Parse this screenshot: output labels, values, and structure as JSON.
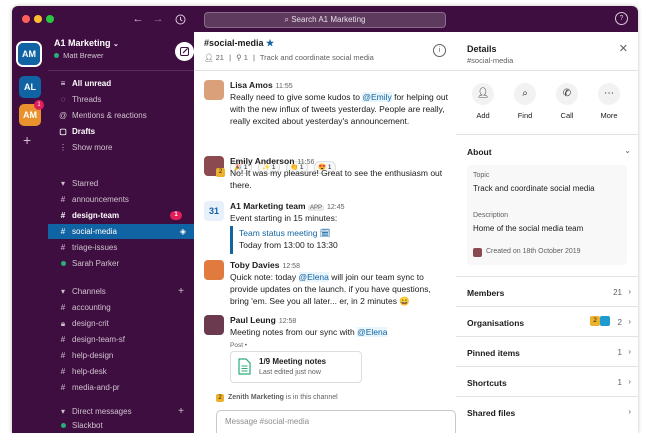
{
  "window": {
    "search_placeholder": "Search A1 Marketing",
    "traffic_colors": [
      "#ff5f57",
      "#febc2e",
      "#28c840"
    ]
  },
  "workspaces": [
    {
      "label": "AM",
      "color": "#1164a3",
      "selected": true
    },
    {
      "label": "AL",
      "color": "#1164a3"
    },
    {
      "label": "AM",
      "color": "#e8912d",
      "badge": "1"
    }
  ],
  "sidebar": {
    "workspace_name": "A1 Marketing",
    "user_name": "Matt Brewer",
    "nav": [
      {
        "label": "All unread",
        "bold": true
      },
      {
        "label": "Threads"
      },
      {
        "label": "Mentions & reactions"
      },
      {
        "label": "Drafts",
        "bold": true
      },
      {
        "label": "Show more"
      }
    ],
    "starred_header": "Starred",
    "starred": [
      {
        "label": "announcements"
      },
      {
        "label": "design-team",
        "bold": true,
        "badge": "1"
      },
      {
        "label": "social-media",
        "active": true
      },
      {
        "label": "triage-issues"
      },
      {
        "label": "Sarah Parker",
        "dm": true
      }
    ],
    "channels_header": "Channels",
    "channels": [
      {
        "label": "accounting"
      },
      {
        "label": "design-crit",
        "locked": true
      },
      {
        "label": "design-team-sf"
      },
      {
        "label": "help-design"
      },
      {
        "label": "help-desk"
      },
      {
        "label": "media-and-pr"
      }
    ],
    "dm_header": "Direct messages",
    "dms": [
      {
        "label": "Slackbot"
      }
    ]
  },
  "channel": {
    "name": "#social-media",
    "members": "21",
    "pins": "1",
    "topic": "Track and coordinate social media"
  },
  "messages": [
    {
      "name": "Lisa Amos",
      "time": "11:55",
      "avatar_color": "#d9a07a"
    },
    {
      "name": "Emily Anderson",
      "time": "11:56",
      "avatar_color": "#8b4a4f",
      "text": "No! It was my pleasure! Great to see the enthusiasm out there."
    },
    {
      "name": "A1 Marketing team",
      "app": "APP",
      "time": "12:45",
      "avatar_color": "#e8f0fb",
      "text": "Event starting in 15 minutes:",
      "event_title": "Team status meeting 🗓",
      "event_time": "Today from 13:00 to 13:30"
    },
    {
      "name": "Toby Davies",
      "time": "12:58",
      "avatar_color": "#e07a3f"
    },
    {
      "name": "Paul Leung",
      "time": "12:58",
      "avatar_color": "#6b3a4f",
      "text_prefix": "Meeting notes from our sync with ",
      "mention": "@Elena",
      "post_label": "Post •",
      "file_title": "1/9 Meeting notes",
      "file_sub": "Last edited just now"
    }
  ],
  "lisa": {
    "t1": "Really need to give some kudos to ",
    "mention": "@Emily",
    "t2": " for helping out with the new influx of tweets yesterday. People are really, really excited about yesterday's announcement."
  },
  "toby": {
    "t1": "Quick note: today ",
    "mention": "@Elena",
    "t2": " will join our team sync to provide updates on the launch. if you have questions, bring 'em. See you all later... er, in 2 minutes 😄"
  },
  "reactions": [
    {
      "emoji": "🎉",
      "count": "1"
    },
    {
      "emoji": "✨",
      "count": "1"
    },
    {
      "emoji": "👏",
      "count": "1"
    },
    {
      "emoji": "😍",
      "count": "1"
    }
  ],
  "shared_note": {
    "org": "Zenith Marketing",
    "suffix": " is in this channel"
  },
  "composer": {
    "placeholder": "Message #social-media"
  },
  "details": {
    "title": "Details",
    "subtitle": "#social-media",
    "actions": [
      {
        "label": "Add",
        "icon": "add-person-icon"
      },
      {
        "label": "Find",
        "icon": "find-icon"
      },
      {
        "label": "Call",
        "icon": "phone-icon"
      },
      {
        "label": "More",
        "icon": "more-icon"
      }
    ],
    "about_title": "About",
    "topic_label": "Topic",
    "topic_value": "Track and coordinate social media",
    "description_label": "Description",
    "description_value": "Home of the social media team",
    "created": "Created on 18th October 2019",
    "members_label": "Members",
    "members_count": "21",
    "organisations_label": "Organisations",
    "organisations_count": "2",
    "pinned_label": "Pinned items",
    "pinned_count": "1",
    "shortcuts_label": "Shortcuts",
    "shortcuts_count": "1",
    "shared_files_label": "Shared files"
  }
}
